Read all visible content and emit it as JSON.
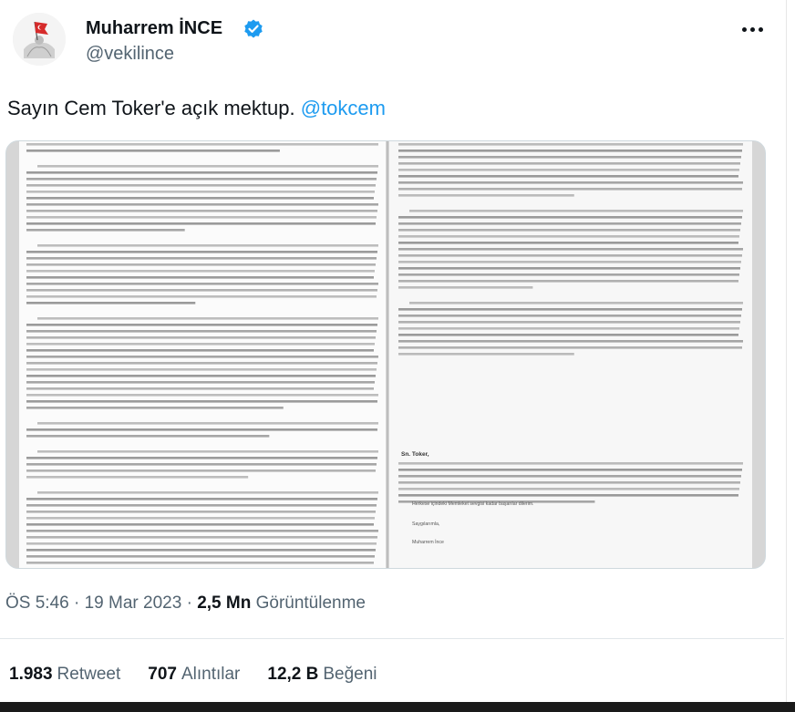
{
  "author": {
    "name": "Muharrem İNCE",
    "handle": "@vekilince",
    "verified": true
  },
  "tweet": {
    "text": "Sayın Cem Toker'e açık mektup.",
    "mention": "@tokcem"
  },
  "meta": {
    "time": "ÖS 5:46",
    "date": "19 Mar 2023",
    "views_count": "2,5 Mn",
    "views_label": "Görüntülenme"
  },
  "stats": {
    "retweets_count": "1.983",
    "retweets_label": "Retweet",
    "quotes_count": "707",
    "quotes_label": "Alıntılar",
    "likes_count": "12,2 B",
    "likes_label": "Beğeni"
  },
  "letter": {
    "salutation": "Sn. Toker,",
    "closing_line": "Herkese içindeki Memleket sevgisi kadar başarılar dilerim.",
    "regards": "Saygılarımla,",
    "signature": "Muharrem İnce"
  },
  "colors": {
    "accent": "#1d9bf0",
    "text": "#0f1419",
    "muted": "#536471"
  },
  "icons": {
    "verified": "verified-badge-icon",
    "more": "more-dots-icon",
    "avatar": "flag-profile-avatar"
  }
}
